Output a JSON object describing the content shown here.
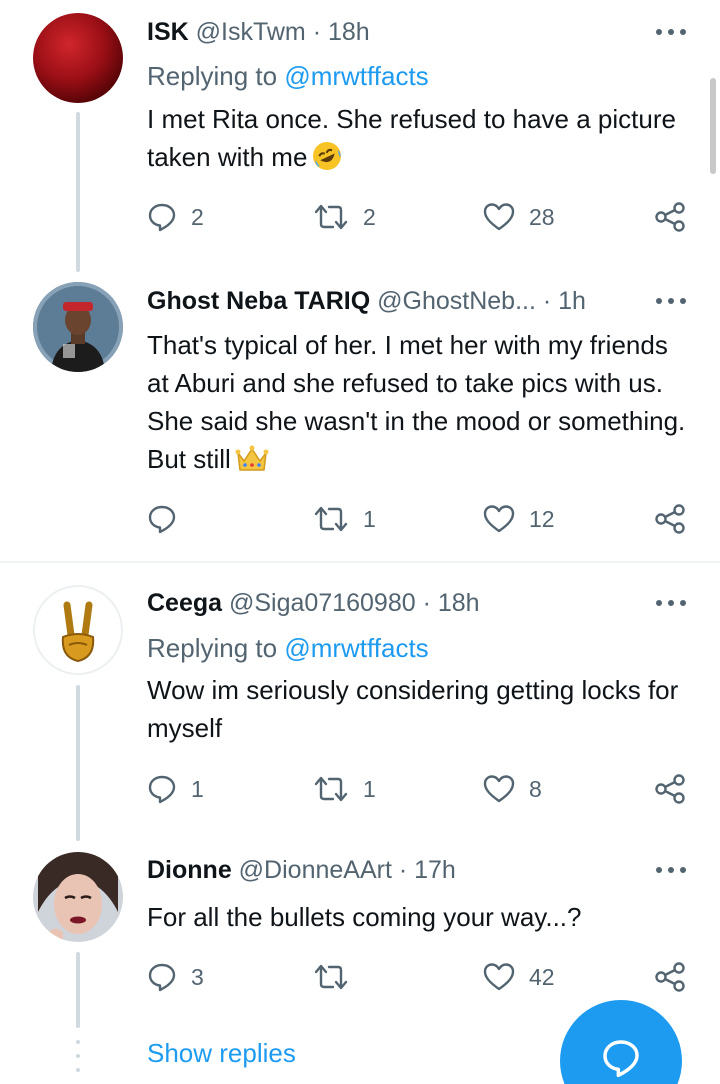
{
  "replies": [
    {
      "display_name": "ISK",
      "handle": "@IskTwm",
      "time": "18h",
      "replying_to_prefix": "Replying to ",
      "replying_to_handle": "@mrwtffacts",
      "text": "I met Rita once. She refused to have a picture taken with me",
      "emoji": "rolling-on-the-floor-laughing",
      "replies": "2",
      "retweets": "2",
      "likes": "28"
    },
    {
      "display_name": "Ghost Neba TARIQ",
      "handle": "@GhostNeb...",
      "time": "1h",
      "text": "That's typical of her. I met her with my friends at Aburi and she refused to take pics with us. She said she wasn't in the mood or something. But still",
      "emoji": "crown",
      "replies": "",
      "retweets": "1",
      "likes": "12"
    },
    {
      "display_name": "Ceega",
      "handle": "@Siga07160980",
      "time": "18h",
      "replying_to_prefix": "Replying to ",
      "replying_to_handle": "@mrwtffacts",
      "text": "Wow im seriously considering getting locks for myself",
      "replies": "1",
      "retweets": "1",
      "likes": "8"
    },
    {
      "display_name": "Dionne",
      "handle": "@DionneAArt",
      "time": "17h",
      "text": "For all the bullets coming your way...?",
      "replies": "3",
      "retweets": "",
      "likes": "42"
    }
  ],
  "separator": " · ",
  "show_replies": "Show replies",
  "colors": {
    "accent": "#1d9bf0",
    "secondary_text": "#536471",
    "thread_line": "#cfd9de",
    "divider": "#eff3f4"
  }
}
